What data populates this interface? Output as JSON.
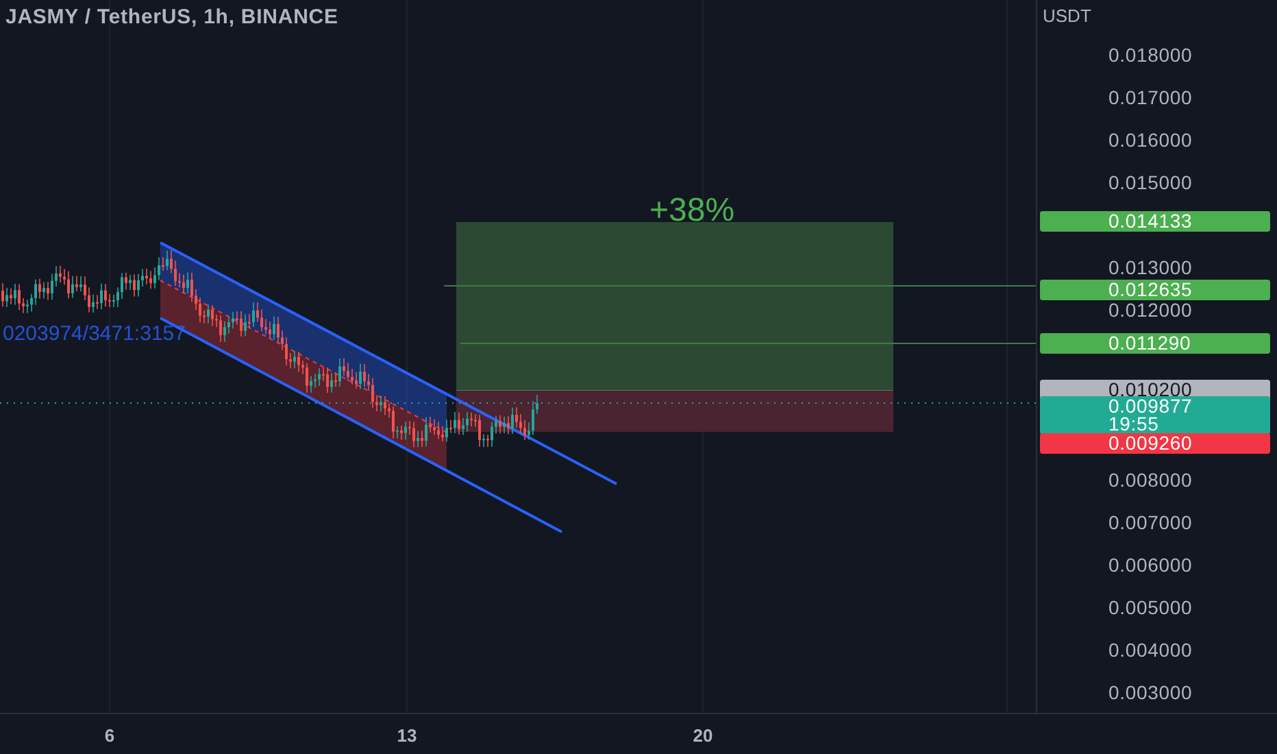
{
  "header": {
    "title": "JASMY / TetherUS, 1h, BINANCE"
  },
  "price_axis": {
    "unit": "USDT",
    "ticks": [
      "0.018000",
      "0.017000",
      "0.016000",
      "0.015000",
      "0.013000",
      "0.012000",
      "0.008000",
      "0.007000",
      "0.006000",
      "0.005000",
      "0.004000",
      "0.003000"
    ]
  },
  "price_labels": [
    {
      "price": "0.014133",
      "color": "#4caf50"
    },
    {
      "price": "0.012635",
      "color": "#4caf50"
    },
    {
      "price": "0.011290",
      "color": "#4caf50"
    },
    {
      "price": "0.010200",
      "color": "#b2b5be"
    },
    {
      "price": "0.009877",
      "countdown": "19:55",
      "color": "#22ab94"
    },
    {
      "price": "0.009260",
      "color": "#f23645"
    }
  ],
  "time_axis": {
    "labels": [
      "6",
      "13",
      "20"
    ]
  },
  "drawings": {
    "channel_label": "0203974/3471:3157",
    "position_label": "+38%"
  }
}
